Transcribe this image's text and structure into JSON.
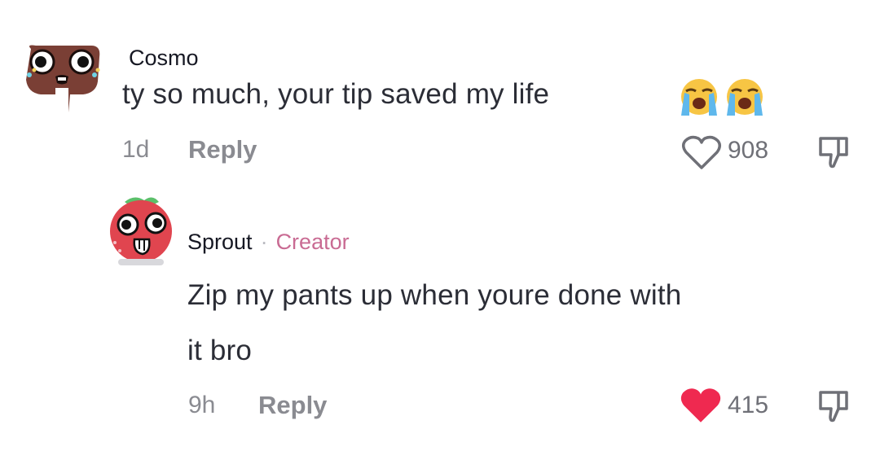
{
  "comments": [
    {
      "username": "Cosmo",
      "text": "ty so much, your tip saved my life",
      "emojis": [
        "loudly-crying-face-icon",
        "loudly-crying-face-icon"
      ],
      "time": "1d",
      "reply_label": "Reply",
      "like_count": "908",
      "liked": false
    },
    {
      "username": "Sprout",
      "separator": "·",
      "badge": "Creator",
      "text_line1": "Zip my pants up when youre done with",
      "text_line2": "it bro",
      "time": "9h",
      "reply_label": "Reply",
      "like_count": "415",
      "liked": true
    }
  ],
  "colors": {
    "liked_heart": "#ef2950",
    "creator_badge": "#c96b93",
    "meta_gray": "#8a8b91"
  }
}
